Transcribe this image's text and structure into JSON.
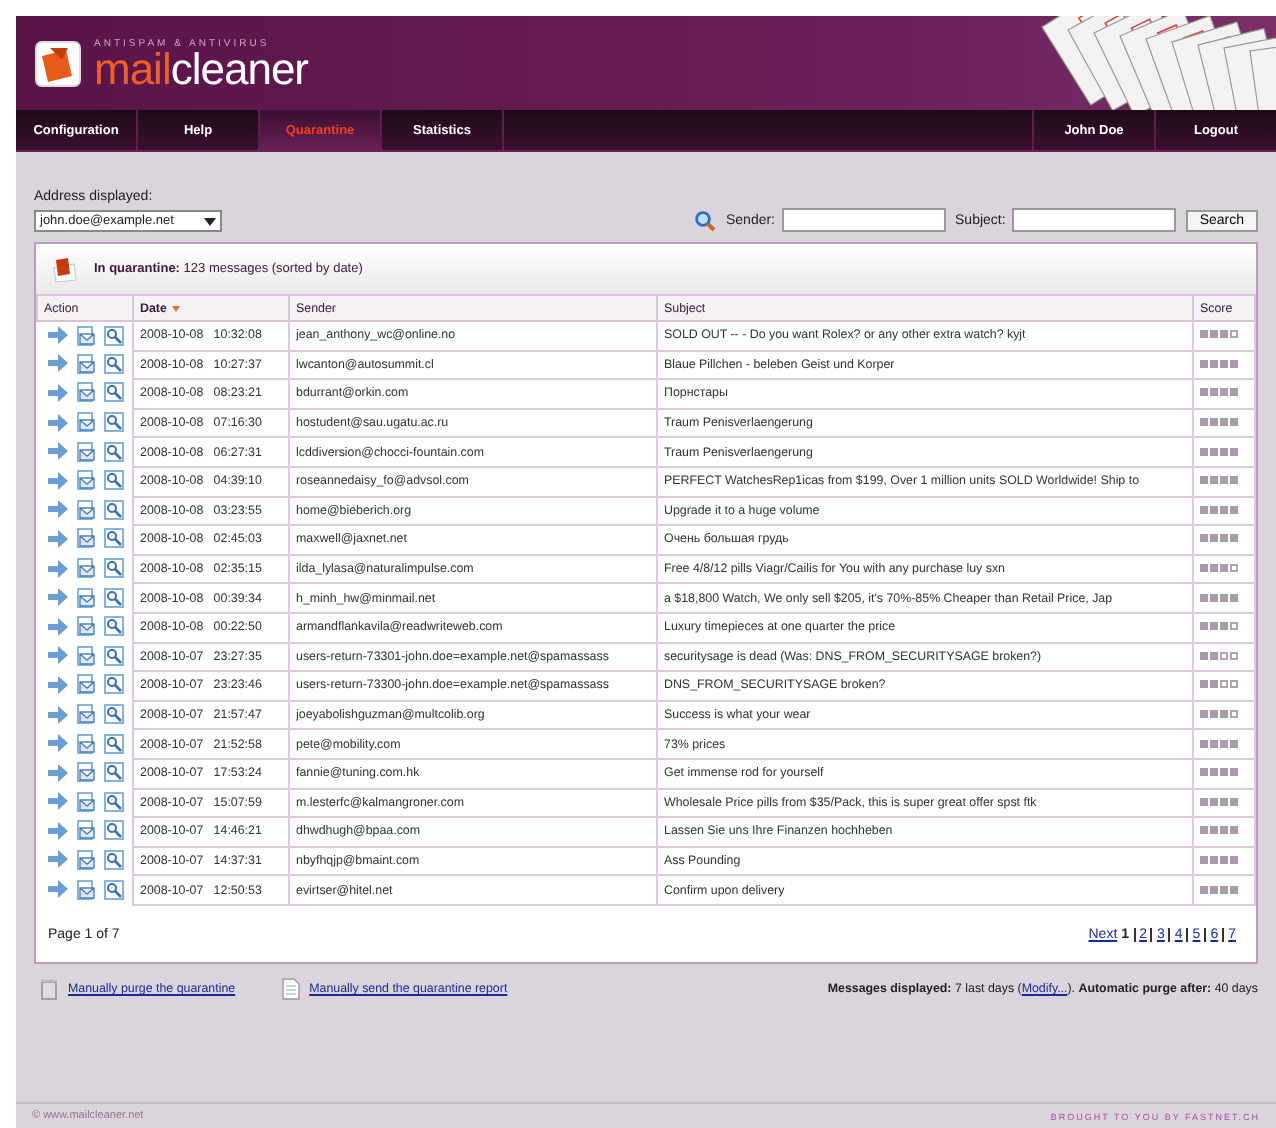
{
  "header": {
    "tagline": "ANTISPAM & ANTIVIRUS",
    "logo_part_1": "mail",
    "logo_part_2": "cleaner"
  },
  "nav": {
    "left": [
      {
        "label": "Configuration",
        "selected": false
      },
      {
        "label": "Help",
        "selected": false
      },
      {
        "label": "Quarantine",
        "selected": true
      },
      {
        "label": "Statistics",
        "selected": false
      }
    ],
    "right": [
      {
        "label": "John Doe",
        "selected": false
      },
      {
        "label": "Logout",
        "selected": false
      }
    ]
  },
  "address": {
    "label": "Address displayed:",
    "value": "john.doe@example.net"
  },
  "search": {
    "sender_label": "Sender:",
    "subject_label": "Subject:",
    "button": "Search"
  },
  "summary": {
    "text": "**In quarantine:** 123 messages (sorted by date)"
  },
  "table": {
    "columns": [
      {
        "label": "Action",
        "sorted": false
      },
      {
        "label": "Date",
        "sorted": true
      },
      {
        "label": "Sender",
        "sorted": false
      },
      {
        "label": "Subject",
        "sorted": false
      },
      {
        "label": "Score",
        "sorted": false
      }
    ],
    "rows": [
      {
        "date": "2008-10-08",
        "time": "10:32:08",
        "sender": "jean_anthony_wc@online.no",
        "subject": "SOLD OUT -- - Do you want Rolex? or any other extra watch? kyjt",
        "stars": 3
      },
      {
        "date": "2008-10-08",
        "time": "10:27:37",
        "sender": "lwcanton@autosummit.cl",
        "subject": "Blaue Pillchen - beleben Geist und Korper",
        "stars": 4
      },
      {
        "date": "2008-10-08",
        "time": "08:23:21",
        "sender": "bdurrant@orkin.com",
        "subject": "Порнстары",
        "stars": 4
      },
      {
        "date": "2008-10-08",
        "time": "07:16:30",
        "sender": "hostudent@sau.ugatu.ac.ru",
        "subject": "Traum Penisverlaengerung",
        "stars": 4
      },
      {
        "date": "2008-10-08",
        "time": "06:27:31",
        "sender": "lcddiversion@chocci-fountain.com",
        "subject": "Traum Penisverlaengerung",
        "stars": 4
      },
      {
        "date": "2008-10-08",
        "time": "04:39:10",
        "sender": "roseannedaisy_fo@advsol.com",
        "subject": "PERFECT WatchesRep1icas from $199, Over 1 million units SOLD Worldwide! Ship to",
        "stars": 4
      },
      {
        "date": "2008-10-08",
        "time": "03:23:55",
        "sender": "home@bieberich.org",
        "subject": "Upgrade it to a huge volume",
        "stars": 4
      },
      {
        "date": "2008-10-08",
        "time": "02:45:03",
        "sender": "maxwell@jaxnet.net",
        "subject": "Очень большая грудь",
        "stars": 4
      },
      {
        "date": "2008-10-08",
        "time": "02:35:15",
        "sender": "ilda_lylasa@naturalimpulse.com",
        "subject": "Free 4/8/12 pills Viagr/Cailis for You with any purchase luy sxn",
        "stars": 3
      },
      {
        "date": "2008-10-08",
        "time": "00:39:34",
        "sender": "h_minh_hw@minmail.net",
        "subject": "a $18,800 Watch, We only sell $205, it's 70%-85% Cheaper than Retail Price, Jap",
        "stars": 4
      },
      {
        "date": "2008-10-08",
        "time": "00:22:50",
        "sender": "armandflankavila@readwriteweb.com",
        "subject": "Luxury timepieces at one quarter the price",
        "stars": 3
      },
      {
        "date": "2008-10-07",
        "time": "23:27:35",
        "sender": "users-return-73301-john.doe=example.net@spamassass",
        "subject": "securitysage is dead (Was: DNS_FROM_SECURITYSAGE broken?)",
        "stars": 2
      },
      {
        "date": "2008-10-07",
        "time": "23:23:46",
        "sender": "users-return-73300-john.doe=example.net@spamassass",
        "subject": "DNS_FROM_SECURITYSAGE broken?",
        "stars": 2
      },
      {
        "date": "2008-10-07",
        "time": "21:57:47",
        "sender": "joeyabolishguzman@multcolib.org",
        "subject": "Success is what your wear",
        "stars": 3
      },
      {
        "date": "2008-10-07",
        "time": "21:52:58",
        "sender": "pete@mobility.com",
        "subject": "73% prices",
        "stars": 4
      },
      {
        "date": "2008-10-07",
        "time": "17:53:24",
        "sender": "fannie@tuning.com.hk",
        "subject": "Get immense rod for yourself",
        "stars": 4
      },
      {
        "date": "2008-10-07",
        "time": "15:07:59",
        "sender": "m.lesterfc@kalmangroner.com",
        "subject": "Wholesale Price pills from $35/Pack, this is super great offer spst ftk",
        "stars": 4
      },
      {
        "date": "2008-10-07",
        "time": "14:46:21",
        "sender": "dhwdhugh@bpaa.com",
        "subject": "Lassen Sie uns Ihre Finanzen hochheben",
        "stars": 4
      },
      {
        "date": "2008-10-07",
        "time": "14:37:31",
        "sender": "nbyfhqjp@bmaint.com",
        "subject": "Ass Pounding",
        "stars": 4
      },
      {
        "date": "2008-10-07",
        "time": "12:50:53",
        "sender": "evirtser@hitel.net",
        "subject": "Confirm upon delivery",
        "stars": 4
      }
    ]
  },
  "pagination": {
    "page_info": "Page 1 of 7",
    "next": "Next",
    "pages": [
      {
        "label": "1",
        "selected": true
      },
      {
        "label": "2",
        "selected": false
      },
      {
        "label": "3",
        "selected": false
      },
      {
        "label": "4",
        "selected": false
      },
      {
        "label": "5",
        "selected": false
      },
      {
        "label": "6",
        "selected": false
      },
      {
        "label": "7",
        "selected": false
      }
    ]
  },
  "actions": {
    "purge": "Manually purge the quarantine",
    "report": "Manually send the quarantine report",
    "info": "**Messages displayed:** 7 last days (",
    "modify": "Modify...",
    "info_end": "). **Automatic purge after:** 40 days"
  },
  "footer": {
    "copyright": "© www.mailcleaner.net",
    "credit": "BROUGHT TO YOU BY FASTNET.CH"
  }
}
